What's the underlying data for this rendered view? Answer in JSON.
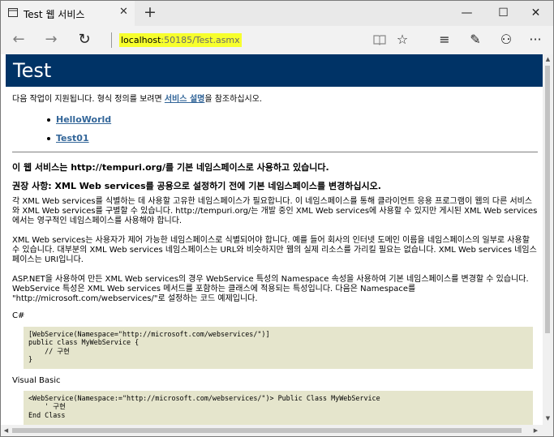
{
  "tab": {
    "title": "Test 웹 서비스",
    "close": "✕",
    "new_tab": "+"
  },
  "window_controls": {
    "minimize": "—",
    "maximize": "☐",
    "close": "✕"
  },
  "nav": {
    "back": "←",
    "forward": "→",
    "refresh": "↻"
  },
  "address": {
    "host": "localhost",
    "path": ":50185/Test.asmx",
    "highlight": "#f7ff2d"
  },
  "toolbar": {
    "reading_view": "📖",
    "favorite": "☆",
    "hub": "≡",
    "notes": "✎",
    "share": "⚇",
    "more": "···"
  },
  "page": {
    "title": "Test",
    "header_color": "#003366",
    "intro_before": "다음 작업이 지원됩니다. 형식 정의를 보려면 ",
    "intro_link": "서비스 설명",
    "intro_after": "을 참조하십시오.",
    "operations": [
      "HelloWorld",
      "Test01"
    ],
    "namespace_notice": "이 웹 서비스는 http://tempuri.org/를 기본 네임스페이스로 사용하고 있습니다.",
    "recommendation": "권장 사항: XML Web services를 공용으로 설정하기 전에 기본 네임스페이스를 변경하십시오.",
    "para1": "각 XML Web services를 식별하는 데 사용할 고유한 네임스페이스가 필요합니다. 이 네임스페이스를 통해 클라이언트 응용 프로그램이 웹의 다른 서비스와 XML Web services를 구별할 수 있습니다. http://tempuri.org/는 개발 중인 XML Web services에 사용할 수 있지만 게시된 XML Web services에서는 영구적인 네임스페이스를 사용해야 합니다.",
    "para2": "XML Web services는 사용자가 제어 가능한 네임스페이스로 식별되어야 합니다. 예를 들어 회사의 인터넷 도메인 이름을 네임스페이스의 일부로 사용할 수 있습니다. 대부분의 XML Web services 네임스페이스는 URL와 비슷하지만 웹의 실제 리소스를 가리킬 필요는 없습니다. XML Web services 네임스페이스는 URI입니다.",
    "para3": "ASP.NET을 사용하여 만든 XML Web services의 경우 WebService 특성의 Namespace 속성을 사용하여 기본 네임스페이스를 변경할 수 있습니다. WebService 특성은 XML Web services 메서드를 포함하는 클래스에 적용되는 특성입니다. 다음은 Namespace를 \"http://microsoft.com/webservices/\"로 설정하는 코드 예제입니다.",
    "csharp_label": "C#",
    "csharp_code": "[WebService(Namespace=\"http://microsoft.com/webservices/\")]\npublic class MyWebService {\n    // 구현\n}",
    "vb_label": "Visual Basic",
    "vb_code": "<WebService(Namespace:=\"http://microsoft.com/webservices/\")> Public Class MyWebService\n    ' 구현\nEnd Class"
  }
}
